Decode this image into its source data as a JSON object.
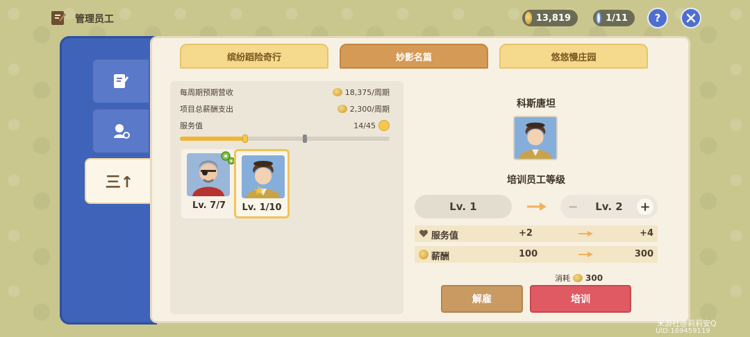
{
  "header": {
    "title": "管理员工",
    "coins": "13,819",
    "staff_count": "1/11",
    "help_label": "?"
  },
  "side_tabs": [
    {
      "icon": "manage-icon"
    },
    {
      "icon": "staff-key-icon"
    },
    {
      "icon": "sort-up-icon",
      "label": "三↑"
    }
  ],
  "tabs": [
    {
      "label": "缤纷蹈险奇行"
    },
    {
      "label": "妙影名篇"
    },
    {
      "label": "悠悠慢庄园"
    }
  ],
  "stats": {
    "weekly_revenue_label": "每周期预期营收",
    "weekly_revenue_value": "18,375/周期",
    "salary_label": "项目总薪酬支出",
    "salary_value": "2,300/周期",
    "service_label": "服务值",
    "service_value": "14/45",
    "service_progress": 0.31
  },
  "staff": [
    {
      "level": "Lv. 7/7",
      "selected": false
    },
    {
      "level": "Lv. 1/10",
      "selected": true
    }
  ],
  "detail": {
    "name": "科斯唐坦",
    "subtitle": "培训员工等级",
    "current_level": "Lv. 1",
    "next_level": "Lv. 2",
    "minus": "−",
    "plus": "+",
    "rows": [
      {
        "label": "服务值",
        "from": "+2",
        "to": "+4"
      },
      {
        "label": "薪酬",
        "from": "100",
        "to": "300"
      }
    ],
    "cost_label": "消耗",
    "cost_value": "300",
    "fire_label": "解雇",
    "train_label": "培训"
  },
  "watermark": {
    "line1": "米游社@莉莉安Q",
    "line2": "UID:169459119"
  },
  "colors": {
    "accent_blue": "#3f63b8",
    "tab_active": "#d59a56",
    "tab_inactive": "#f5d98c",
    "train_red": "#df5a62",
    "fire_tan": "#c99a62"
  }
}
